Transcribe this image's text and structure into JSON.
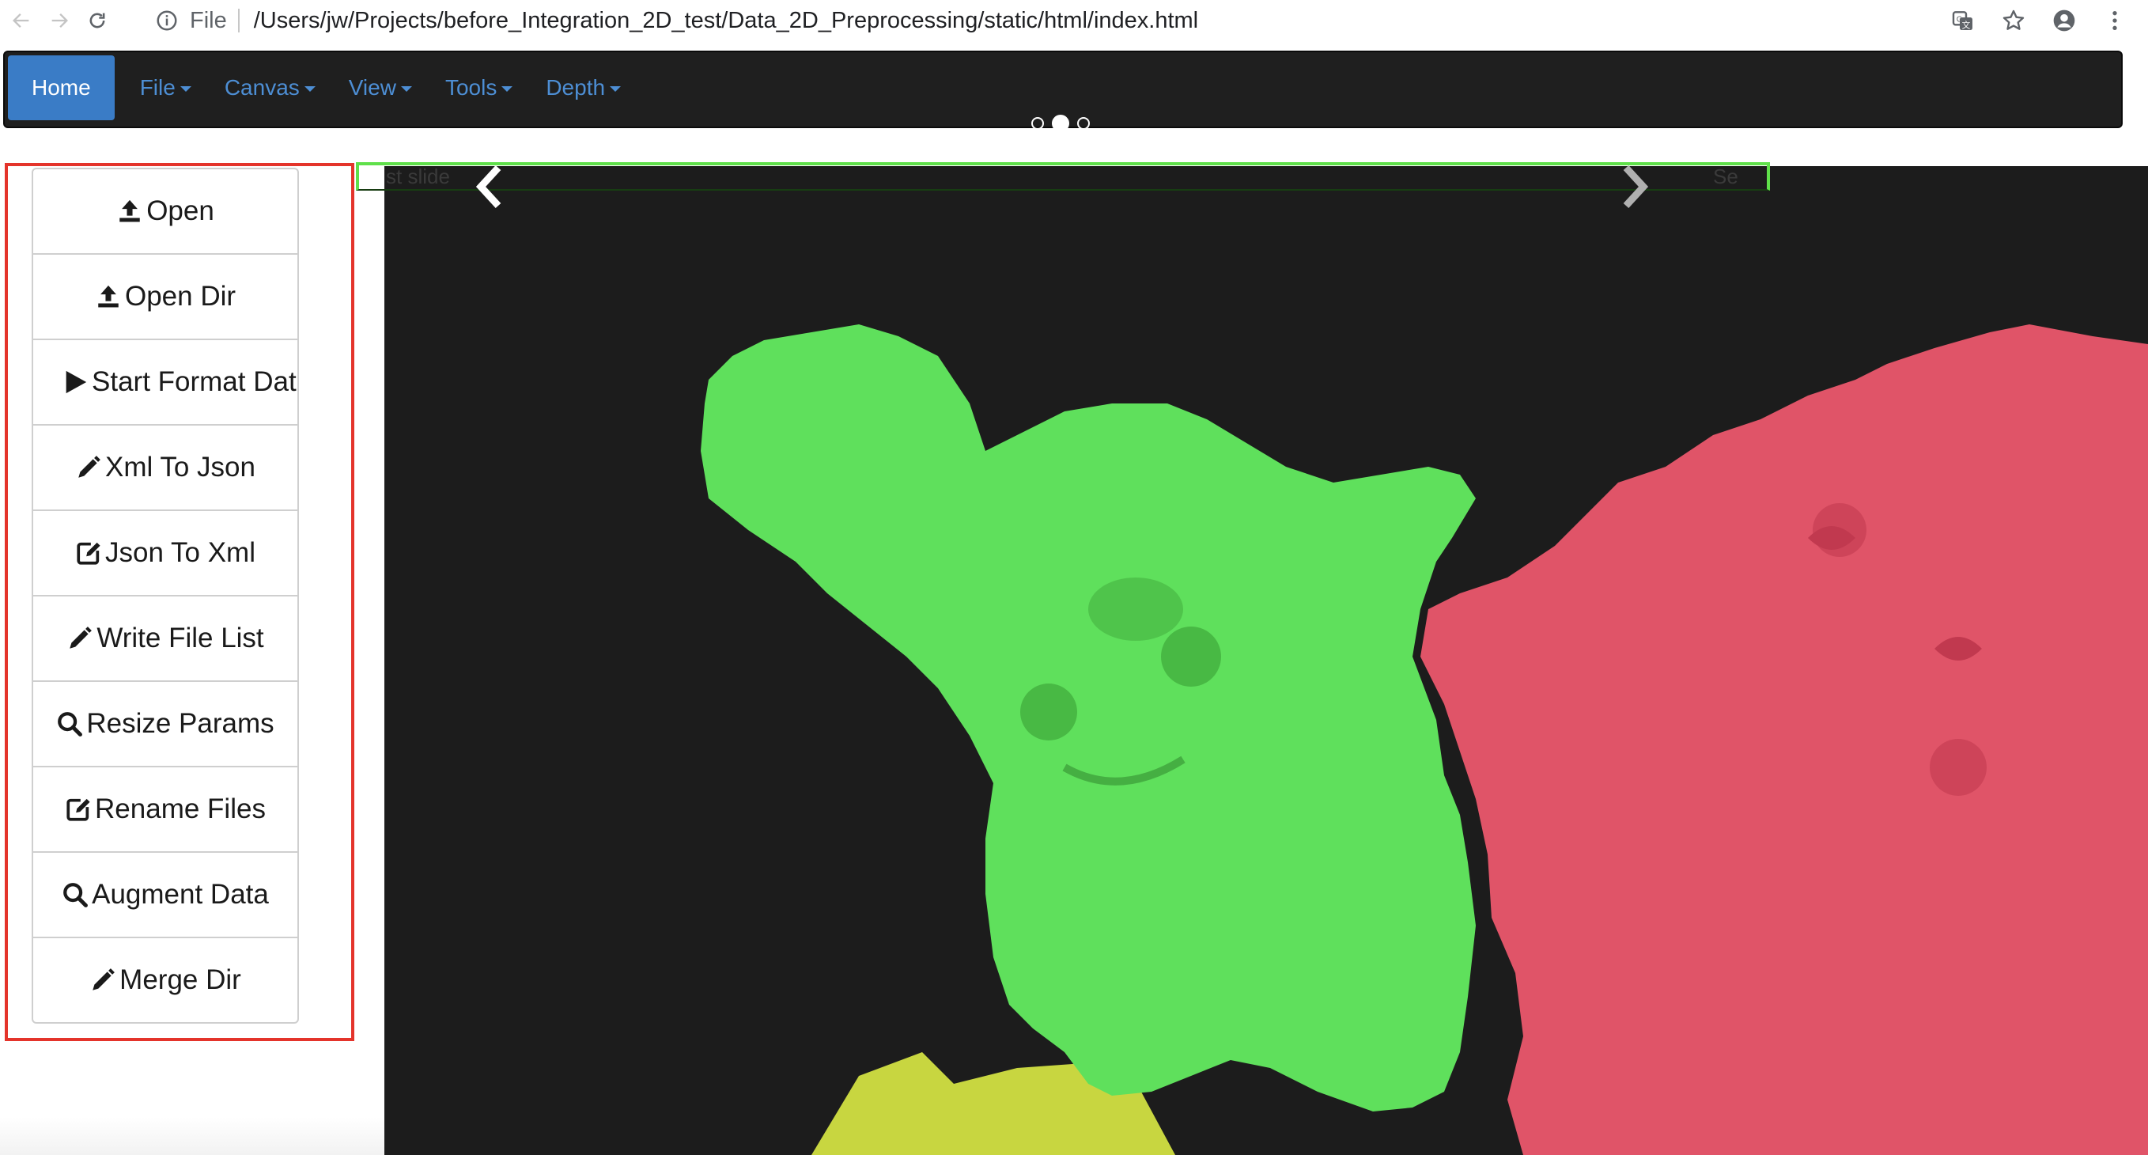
{
  "browser": {
    "scheme_label": "File",
    "url": "/Users/jw/Projects/before_Integration_2D_test/Data_2D_Preprocessing/static/html/index.html",
    "icons": [
      "back-arrow-icon",
      "forward-arrow-icon",
      "reload-icon",
      "info-icon",
      "translate-icon",
      "star-icon",
      "account-icon",
      "more-vert-icon"
    ]
  },
  "navbar": {
    "home": "Home",
    "menus": [
      {
        "label": "File"
      },
      {
        "label": "Canvas"
      },
      {
        "label": "View"
      },
      {
        "label": "Tools"
      },
      {
        "label": "Depth"
      }
    ],
    "indicator_count": 3,
    "active_indicator": 1
  },
  "sidebar": {
    "buttons": [
      {
        "label": "Open",
        "icon": "upload-icon"
      },
      {
        "label": "Open Dir",
        "icon": "upload-icon"
      },
      {
        "label": "Start Format Dat",
        "icon": "play-icon"
      },
      {
        "label": "Xml To Json",
        "icon": "pencil-icon"
      },
      {
        "label": "Json To Xml",
        "icon": "edit-icon"
      },
      {
        "label": "Write File List",
        "icon": "pencil-icon"
      },
      {
        "label": "Resize Params",
        "icon": "search-icon"
      },
      {
        "label": "Rename Files",
        "icon": "edit-icon"
      },
      {
        "label": "Augment Data",
        "icon": "search-icon"
      },
      {
        "label": "Merge Dir",
        "icon": "pencil-icon"
      }
    ]
  },
  "carousel": {
    "prev_alt": "st slide",
    "next_alt": "Se",
    "prev_icon": "chevron-left-icon",
    "next_icon": "chevron-right-icon"
  },
  "colors": {
    "navbar_bg": "#1f1f1f",
    "home_active": "#3a7cc6",
    "nav_link": "#4d8ed4",
    "sidebar_frame": "#e4342b",
    "slide_border": "#5fe04a",
    "mask_green": "#5fe05c",
    "mask_red": "#e05468",
    "mask_yellow": "#c8d640",
    "canvas_bg": "#1c1c1c"
  }
}
